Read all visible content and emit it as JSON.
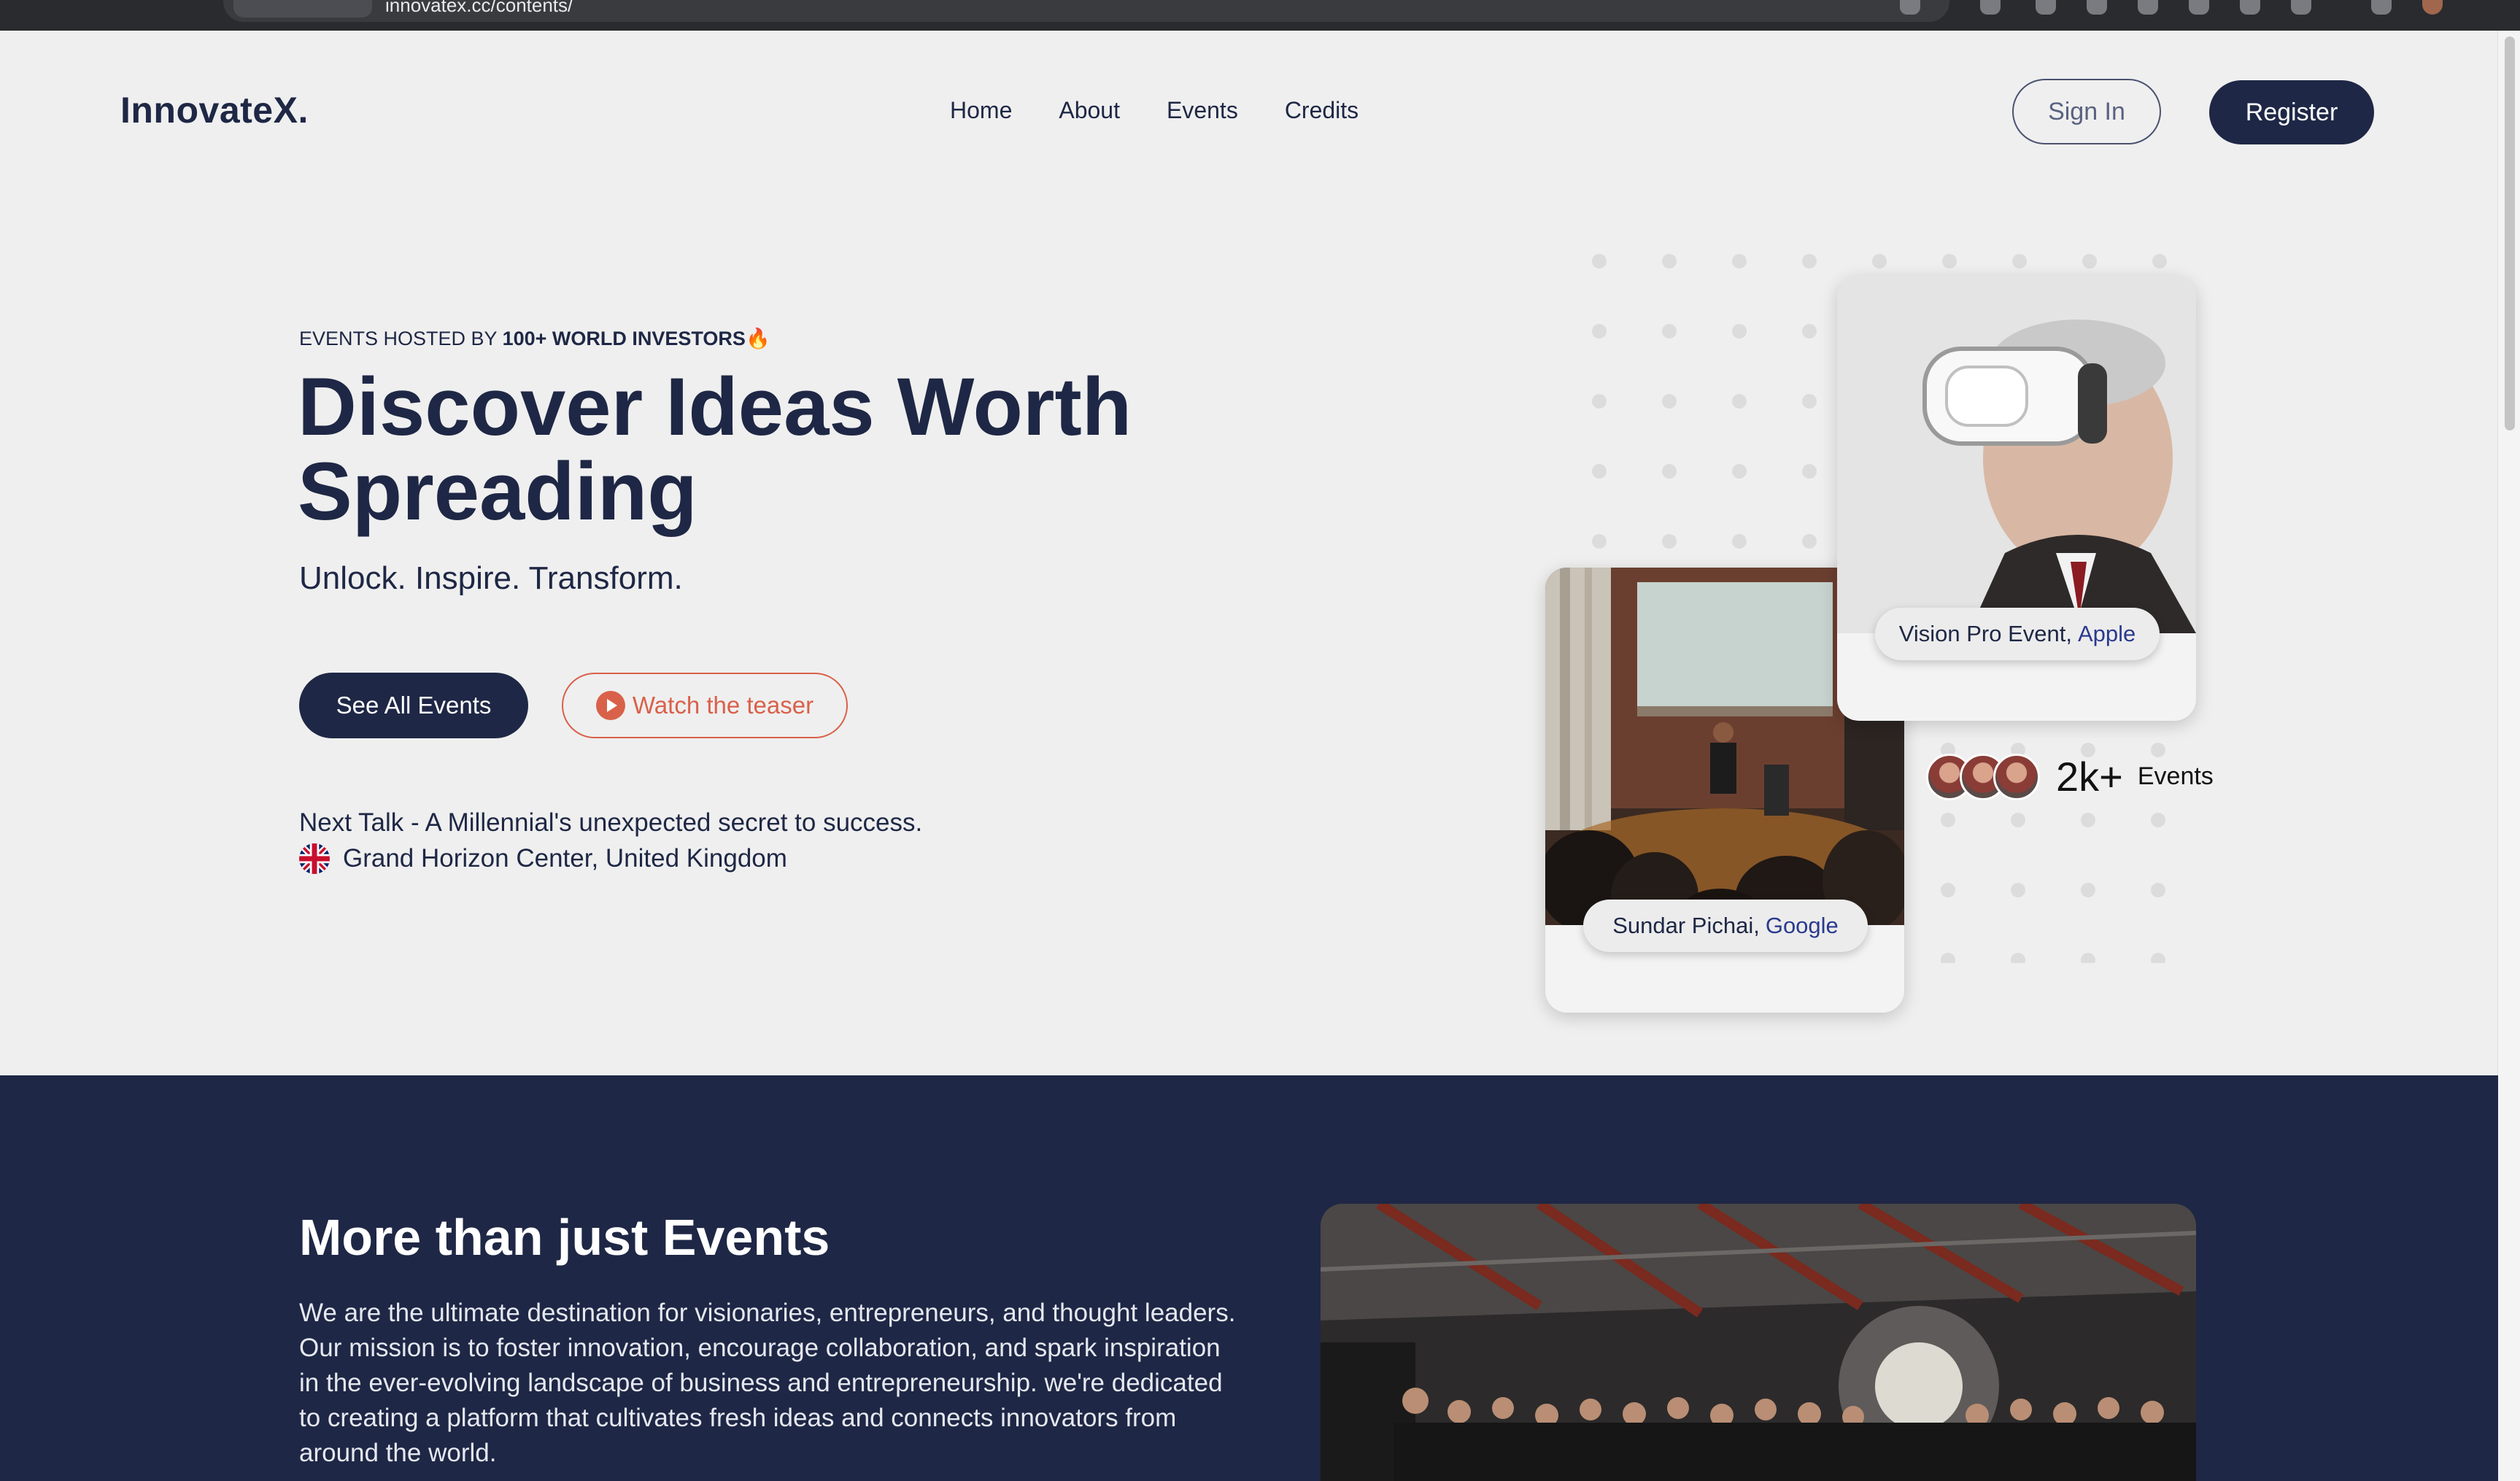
{
  "browser": {
    "url": "innovatex.cc/contents/"
  },
  "header": {
    "logo": "InnovateX.",
    "nav": [
      "Home",
      "About",
      "Events",
      "Credits"
    ],
    "sign_in": "Sign In",
    "register": "Register"
  },
  "hero": {
    "eyebrow_prefix": "EVENTS HOSTED BY",
    "eyebrow_bold": "100+ WORLD INVESTORS",
    "eyebrow_icon": "fire-icon",
    "title": "Discover Ideas Worth Spreading",
    "subtitle": "Unlock. Inspire. Transform.",
    "primary_button": "See All Events",
    "secondary_button": "Watch the teaser",
    "next_talk": "Next Talk - A Millennial's unexpected secret to success.",
    "venue": "Grand Horizon Center, United Kingdom",
    "venue_icon": "uk-flag-icon"
  },
  "cards": {
    "vision": {
      "label": "Vision Pro Event,",
      "company": "Apple"
    },
    "talk": {
      "label": "Sundar Pichai,",
      "company": "Google"
    }
  },
  "stats": {
    "count": "2k+",
    "label": "Events"
  },
  "about": {
    "title": "More than just Events",
    "text": "We are the ultimate destination for visionaries, entrepreneurs, and thought leaders. Our mission is to foster innovation, encourage collaboration, and spark inspiration in the ever-evolving landscape of business and entrepreneurship. we're dedicated to creating a platform that cultivates fresh ideas and connects innovators from around the world."
  },
  "colors": {
    "navy": "#1e2745",
    "accent_orange": "#d9614a",
    "company_blue": "#2a3a8f",
    "page_bg": "#efefef"
  }
}
